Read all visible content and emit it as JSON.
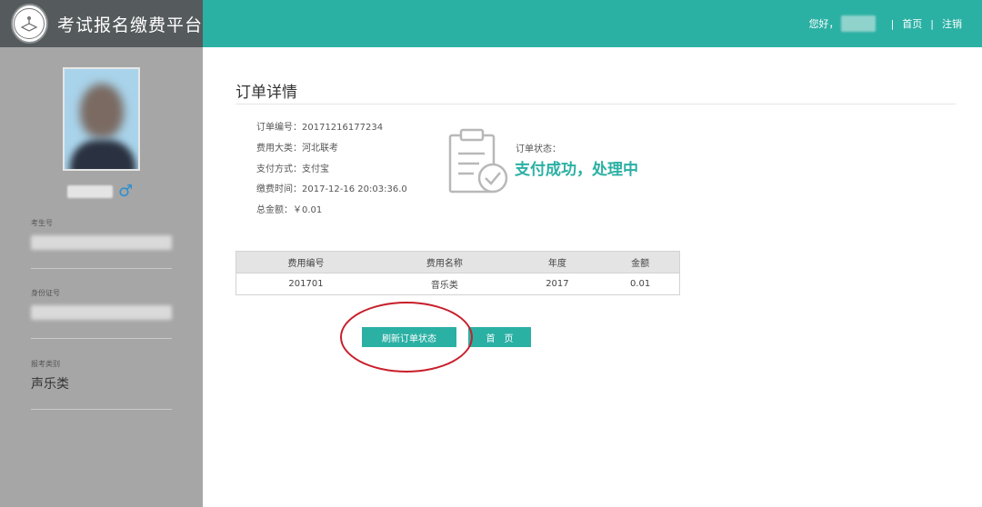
{
  "header": {
    "brand_title": "考试报名缴费平台",
    "greeting": "您好，",
    "separator": "|",
    "home_link": "首页",
    "logout_link": "注销"
  },
  "sidebar": {
    "gender_symbol": "♂",
    "fields": {
      "exam_number_label": "考生号",
      "id_number_label": "身份证号",
      "category_label": "报考类别",
      "category_value": "声乐类"
    }
  },
  "order": {
    "page_title": "订单详情",
    "order_number": "订单编号：20171216177234",
    "fee_category": "费用大类：河北联考",
    "payment_method": "支付方式：支付宝",
    "payment_time": "缴费时间：2017-12-16 20:03:36.0",
    "total_amount": "总金额：￥0.01",
    "status_label": "订单状态：",
    "status_text": "支付成功，处理中"
  },
  "table": {
    "headers": [
      "费用编号",
      "费用名称",
      "年度",
      "金额"
    ],
    "rows": [
      [
        "201701",
        "音乐类",
        "2017",
        "0.01"
      ]
    ]
  },
  "buttons": {
    "refresh_label": "刷新订单状态",
    "home_label": "首页"
  },
  "colors": {
    "accent": "#2bb0a4",
    "sidebar_bg": "#a6a6a6",
    "brand_bg": "#555a5d",
    "highlight_ring": "#c81e2a"
  },
  "icons": {
    "logo": "school-seal-icon",
    "gender": "male-symbol-icon",
    "status": "clipboard-check-icon"
  }
}
